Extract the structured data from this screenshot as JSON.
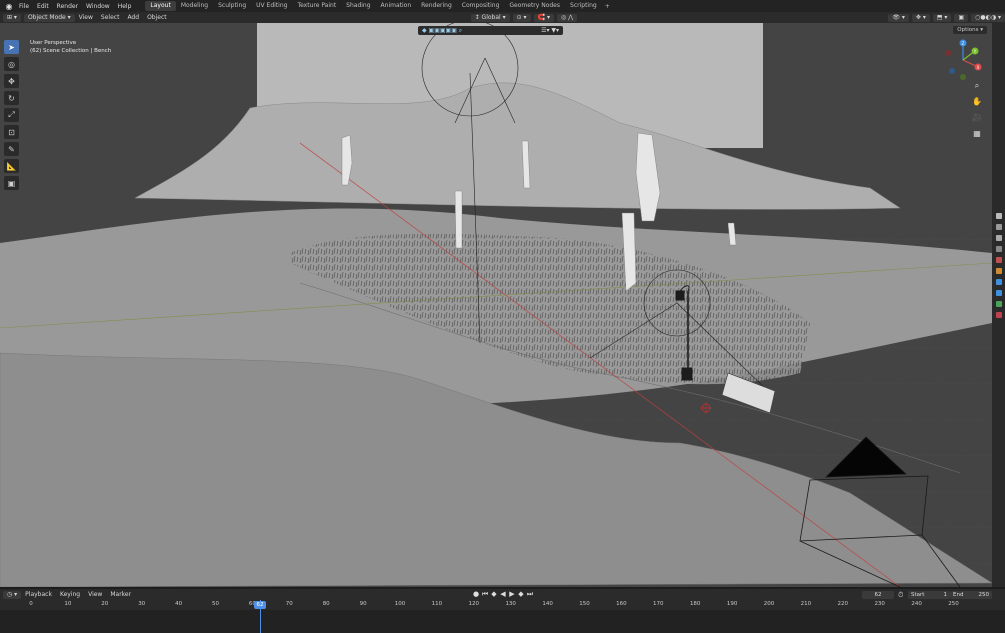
{
  "top_menu": [
    "File",
    "Edit",
    "Render",
    "Window",
    "Help"
  ],
  "workspace_tabs": [
    "Layout",
    "Modeling",
    "Sculpting",
    "UV Editing",
    "Texture Paint",
    "Shading",
    "Animation",
    "Rendering",
    "Compositing",
    "Geometry Nodes",
    "Scripting"
  ],
  "active_tab": "Layout",
  "add_tab_label": "+",
  "header": {
    "mode": "Object Mode",
    "menus": [
      "View",
      "Select",
      "Add",
      "Object"
    ],
    "transform_orientation": "Global",
    "options_label": "Options"
  },
  "viewport": {
    "view_name": "User Perspective",
    "collection_info": "(62) Scene Collection | Bench"
  },
  "gizmo_axes": [
    "X",
    "Y",
    "Z"
  ],
  "colors": {
    "accent": "#4772b3",
    "x_axis": "#e04c4c",
    "y_axis": "#7cbf2c",
    "z_axis": "#3d8fe0",
    "playhead": "#4f8fe6"
  },
  "timeline": {
    "menus": [
      "Playback",
      "Keying",
      "View",
      "Marker"
    ],
    "current_frame": "62",
    "start_label": "Start",
    "start_value": "1",
    "end_label": "End",
    "end_value": "250",
    "ticks": [
      "0",
      "10",
      "20",
      "30",
      "40",
      "50",
      "60",
      "70",
      "80",
      "90",
      "100",
      "110",
      "120",
      "130",
      "140",
      "150",
      "160",
      "170",
      "180",
      "190",
      "200",
      "210",
      "220",
      "230",
      "240",
      "250"
    ]
  }
}
